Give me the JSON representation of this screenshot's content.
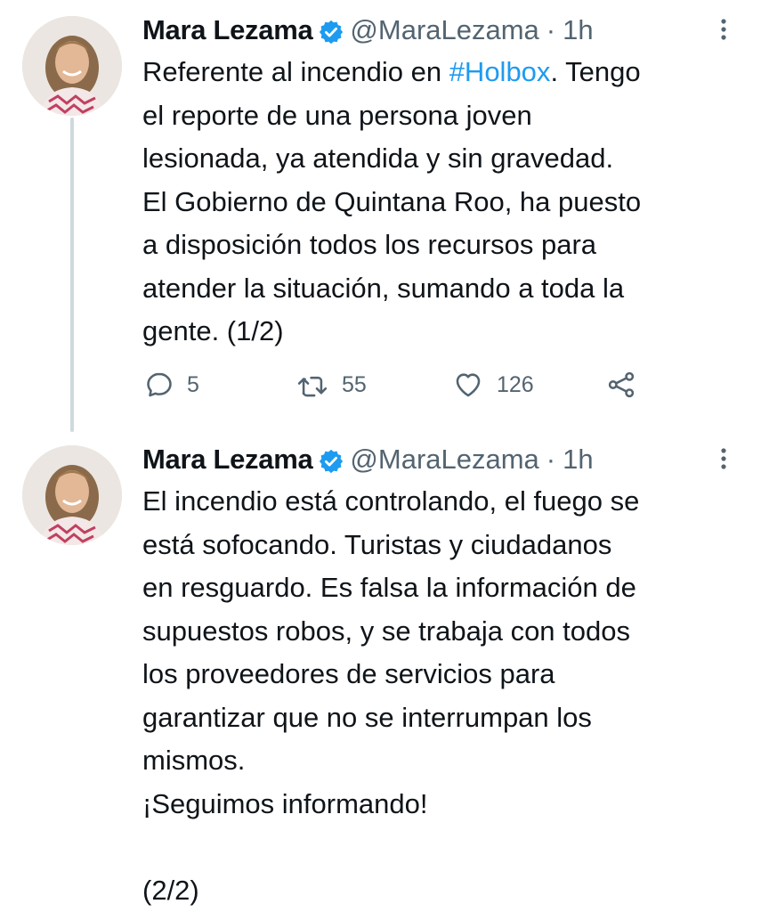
{
  "thread": [
    {
      "author": {
        "display_name": "Mara Lezama",
        "handle": "@MaraLezama",
        "verified": true
      },
      "separator": "·",
      "time": "1h",
      "text_before_hashtag": "Referente al incendio en ",
      "hashtag": "#Holbox",
      "text_after_hashtag": ". Tengo\nel reporte de una persona joven\nlesionada, ya atendida y sin gravedad.\nEl Gobierno de Quintana Roo, ha puesto\na disposición todos los recursos para\natender la situación, sumando a toda la\ngente. (1/2)",
      "actions": {
        "replies": "5",
        "retweets": "55",
        "likes": "126"
      }
    },
    {
      "author": {
        "display_name": "Mara Lezama",
        "handle": "@MaraLezama",
        "verified": true
      },
      "separator": "·",
      "time": "1h",
      "text": "El incendio está controlando, el fuego se\nestá sofocando. Turistas y ciudadanos\nen resguardo. Es falsa la información de\nsupuestos robos, y se trabaja con todos\nlos proveedores de servicios para\ngarantizar que no se interrumpan los\nmismos.\n¡Seguimos informando!\n\n(2/2)"
    }
  ],
  "colors": {
    "text": "#0f1419",
    "secondary": "#536471",
    "accent": "#1d9bf0",
    "thread_line": "#cfd9de"
  },
  "icons": [
    "verified-badge-icon",
    "more-options-icon",
    "reply-icon",
    "retweet-icon",
    "like-icon",
    "share-icon"
  ]
}
